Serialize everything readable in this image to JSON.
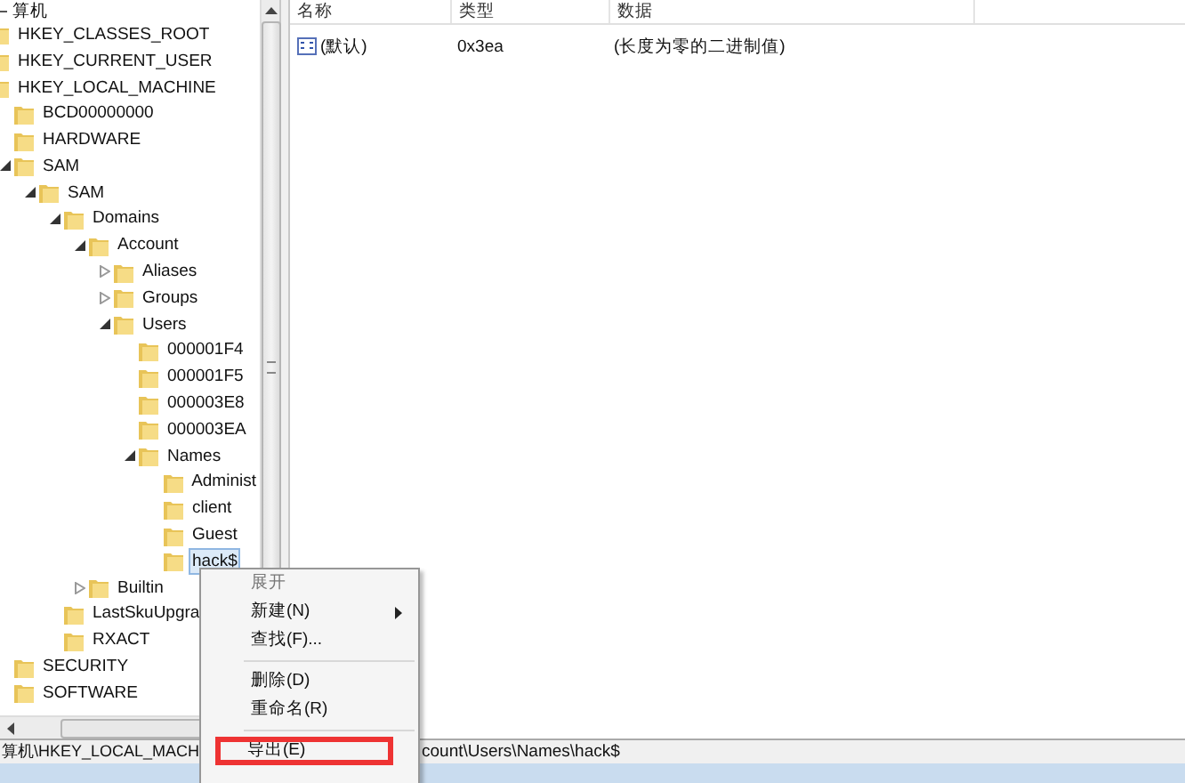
{
  "tree": {
    "label": "算机",
    "expanded": true,
    "children": [
      {
        "label": "HKEY_CLASSES_ROOT"
      },
      {
        "label": "HKEY_CURRENT_USER"
      },
      {
        "label": "HKEY_LOCAL_MACHINE",
        "expanded": true,
        "children": [
          {
            "label": "BCD00000000"
          },
          {
            "label": "HARDWARE"
          },
          {
            "label": "SAM",
            "expanded": true,
            "children": [
              {
                "label": "SAM",
                "expanded": true,
                "children": [
                  {
                    "label": "Domains",
                    "expanded": true,
                    "children": [
                      {
                        "label": "Account",
                        "expanded": true,
                        "children": [
                          {
                            "label": "Aliases",
                            "expanded": false
                          },
                          {
                            "label": "Groups",
                            "expanded": false
                          },
                          {
                            "label": "Users",
                            "expanded": true,
                            "children": [
                              {
                                "label": "000001F4"
                              },
                              {
                                "label": "000001F5"
                              },
                              {
                                "label": "000003E8"
                              },
                              {
                                "label": "000003EA"
                              },
                              {
                                "label": "Names",
                                "expanded": true,
                                "children": [
                                  {
                                    "label": "Administ",
                                    "selected": false
                                  },
                                  {
                                    "label": "client",
                                    "selected": false
                                  },
                                  {
                                    "label": "Guest",
                                    "selected": false
                                  },
                                  {
                                    "label": "hack$",
                                    "selected": true
                                  }
                                ]
                              }
                            ]
                          }
                        ]
                      },
                      {
                        "label": "Builtin",
                        "expanded": false
                      }
                    ]
                  },
                  {
                    "label": "LastSkuUpgra"
                  },
                  {
                    "label": "RXACT"
                  }
                ]
              }
            ]
          },
          {
            "label": "SECURITY"
          },
          {
            "label": "SOFTWARE"
          }
        ]
      }
    ]
  },
  "list": {
    "columns": [
      "名称",
      "类型",
      "数据"
    ],
    "rows": [
      {
        "name": "(默认)",
        "type": "0x3ea",
        "data": "(长度为零的二进制值)"
      }
    ]
  },
  "context_menu": [
    {
      "kind": "item",
      "label": "展开",
      "disabled": true,
      "submenu": false
    },
    {
      "kind": "item",
      "label": "新建(N)",
      "disabled": false,
      "submenu": true
    },
    {
      "kind": "item",
      "label": "查找(F)...",
      "disabled": false,
      "submenu": false
    },
    {
      "kind": "separator"
    },
    {
      "kind": "item",
      "label": "删除(D)",
      "disabled": false,
      "submenu": false
    },
    {
      "kind": "item",
      "label": "重命名(R)",
      "disabled": false,
      "submenu": false
    },
    {
      "kind": "separator"
    },
    {
      "kind": "item",
      "label": "导出(E)",
      "disabled": false,
      "submenu": false,
      "highlighted": true
    }
  ],
  "status_bar": [
    "算机\\HKEY_LOCAL_MACH",
    "count\\Users\\Names\\hack$"
  ]
}
